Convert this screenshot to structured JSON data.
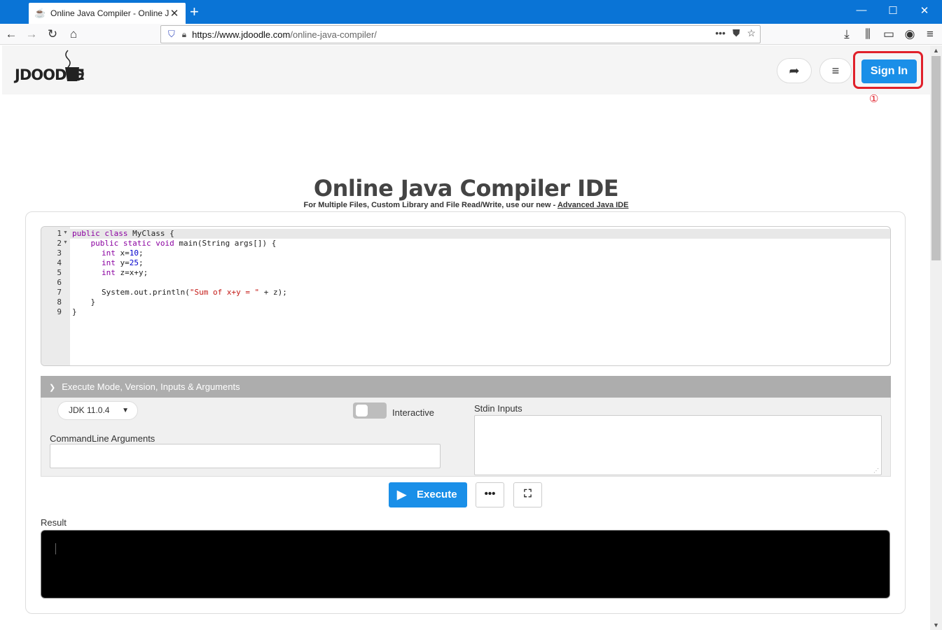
{
  "browser": {
    "tab_title": "Online Java Compiler - Online J",
    "tab_favicon": "coffee-cup-icon",
    "new_tab_label": "+",
    "url_host": "https://www.jdoodle.com",
    "url_path": "/online-java-compiler/",
    "url_more": "•••",
    "win_minimize": "—",
    "win_maximize": "☐",
    "win_close": "✕"
  },
  "header": {
    "logo_text": "JDOODLE",
    "share_icon": "share-arrow-icon",
    "menu_icon": "hamburger-menu-icon",
    "signin_label": "Sign In",
    "annotation": "①",
    "accent_color": "#1a8fe8",
    "highlight_color": "#e0202a"
  },
  "main": {
    "title": "Online Java Compiler IDE",
    "subtitle_prefix": "For Multiple Files, Custom Library and File Read/Write, use our new - ",
    "subtitle_link": "Advanced Java IDE"
  },
  "editor": {
    "line_numbers": [
      "1",
      "2",
      "3",
      "4",
      "5",
      "6",
      "7",
      "8",
      "9"
    ],
    "code": {
      "l1_kw": "public class",
      "l1_rest": " MyClass {",
      "l2_indent": "    ",
      "l2_kw": "public static void",
      "l2_rest": " main(String args[]) {",
      "l3_kw": "int",
      "l3_a": " x=",
      "l3_num": "10",
      "l3_end": ";",
      "l4_kw": "int",
      "l4_a": " y=",
      "l4_num": "25",
      "l4_end": ";",
      "l5_kw": "int",
      "l5_rest": " z=x+y;",
      "l7_a": "System.out.println(",
      "l7_str": "\"Sum of x+y = \"",
      "l7_end": " + z);",
      "l8": "    }",
      "l9": "}"
    }
  },
  "options_panel": {
    "header": "Execute Mode, Version, Inputs & Arguments",
    "jdk_version": "JDK 11.0.4",
    "interactive_label": "Interactive",
    "interactive_on": false,
    "cmd_label": "CommandLine Arguments",
    "cmd_value": "",
    "stdin_label": "Stdin Inputs",
    "stdin_value": ""
  },
  "actions": {
    "execute_label": "Execute",
    "more_label": "•••",
    "fullscreen_icon": "fullscreen-icon"
  },
  "result": {
    "label": "Result",
    "output": ""
  }
}
